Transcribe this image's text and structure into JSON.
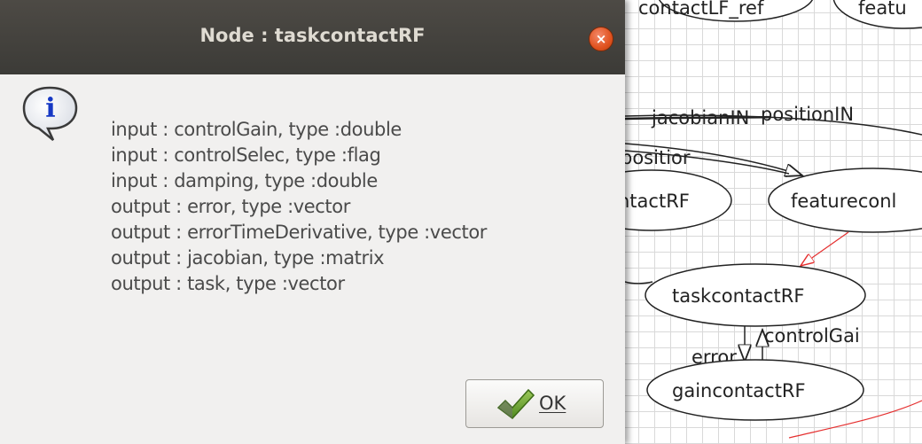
{
  "dialog": {
    "title": "Node : taskcontactRF",
    "close_label": "×",
    "icon": "info-icon",
    "lines": [
      "input : controlGain, type :double",
      "input : controlSelec, type :flag",
      "input : damping, type :double",
      "output : error, type :vector",
      "output : errorTimeDerivative, type :vector",
      "output : jacobian, type :matrix",
      "output : task, type :vector"
    ],
    "ok_label": "OK",
    "ok_icon": "checkmark-icon"
  },
  "graph": {
    "nodes": {
      "top_left": "contactLF_ref",
      "top_right": "featu",
      "left_mid": "ntactRF",
      "right_mid": "featureconl",
      "task": "taskcontactRF",
      "gain": "gaincontactRF"
    },
    "edge_labels": {
      "jacobian": "jacobianIN",
      "position_top": "positionIN",
      "position_mid": "positior",
      "control_gain": "controlGai",
      "error": "error"
    }
  },
  "colors": {
    "titlebar": "#3c3b37",
    "dialog_bg": "#f1f0ef",
    "close_button": "#e0521f",
    "red_edge": "#e53030",
    "grid": "#d9d9d9"
  }
}
